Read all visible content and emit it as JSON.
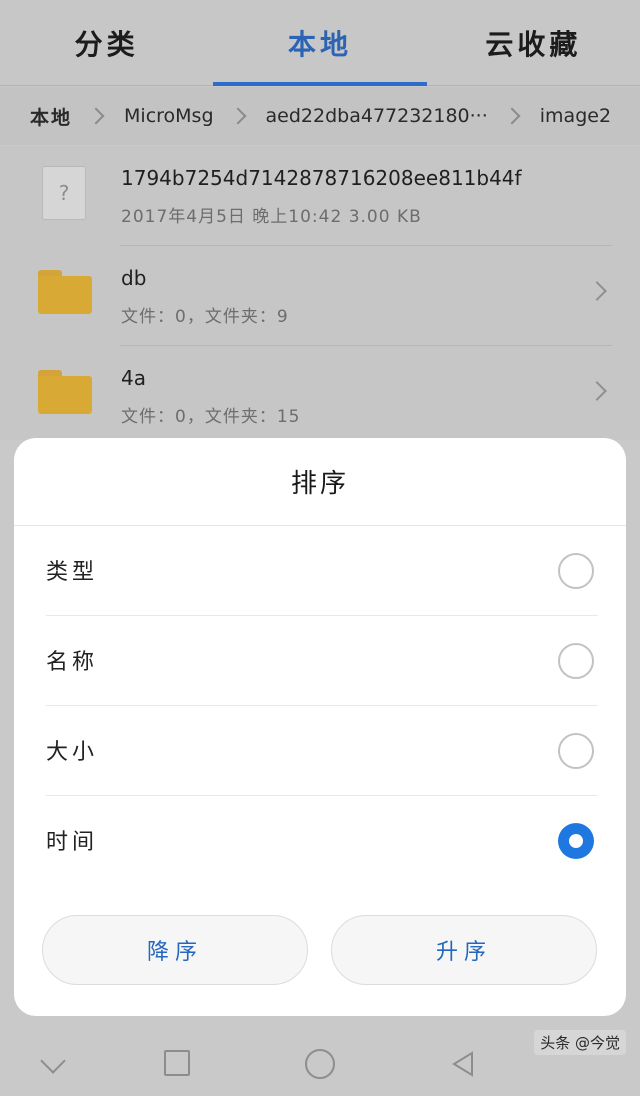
{
  "tabs": [
    {
      "label": "分类",
      "active": false
    },
    {
      "label": "本地",
      "active": true
    },
    {
      "label": "云收藏",
      "active": false
    }
  ],
  "breadcrumb": [
    "本地",
    "MicroMsg",
    "aed22dba477232180···",
    "image2"
  ],
  "files": [
    {
      "name": "1794b7254d7142878716208ee811b44f",
      "meta": "2017年4月5日 晚上10:42 3.00 KB",
      "icon": "unknown-file-icon"
    },
    {
      "name": "db",
      "meta": "文件：0，文件夹：9",
      "icon": "folder-icon"
    },
    {
      "name": "4a",
      "meta": "文件：0，文件夹：15",
      "icon": "folder-icon"
    }
  ],
  "sort_dialog": {
    "title": "排序",
    "options": [
      {
        "label": "类型",
        "checked": false
      },
      {
        "label": "名称",
        "checked": false
      },
      {
        "label": "大小",
        "checked": false
      },
      {
        "label": "时间",
        "checked": true
      }
    ],
    "descending_label": "降序",
    "ascending_label": "升序"
  },
  "watermark": "头条 @今觉",
  "colors": {
    "accent": "#2d6cc8",
    "radio_checked": "#1e78df",
    "folder": "#d9a935"
  }
}
